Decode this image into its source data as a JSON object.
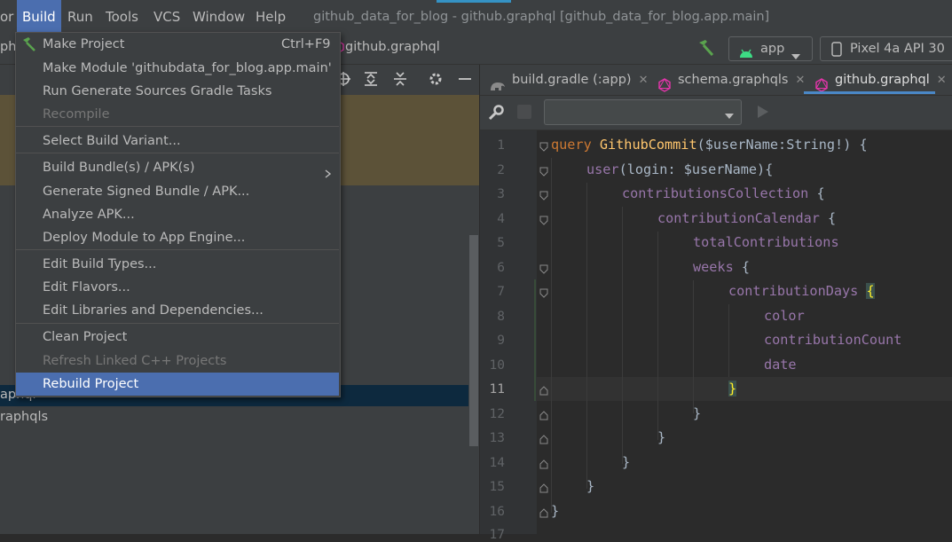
{
  "menubar": {
    "items": [
      {
        "label": "or"
      },
      {
        "label": "Build"
      },
      {
        "label": "Run"
      },
      {
        "label": "Tools"
      },
      {
        "label": "VCS"
      },
      {
        "label": "Window"
      },
      {
        "label": "Help"
      }
    ],
    "window_title": "github_data_for_blog - github.graphql [github_data_for_blog.app.main]"
  },
  "toolbar": {
    "breadcrumb_left": "ph",
    "breadcrumb_file": "github.graphql",
    "run_config": "app",
    "device": "Pixel 4a API 30"
  },
  "project_tree": {
    "rows": [
      {
        "label": "aphql"
      },
      {
        "label": "raphqls"
      }
    ]
  },
  "build_menu": {
    "items": [
      {
        "label": "Make Project",
        "shortcut": "Ctrl+F9"
      },
      {
        "label": "Make Module 'githubdata_for_blog.app.main'"
      },
      {
        "label": "Run Generate Sources Gradle Tasks"
      },
      {
        "label": "Recompile"
      },
      {
        "label": "Select Build Variant..."
      },
      {
        "label": "Build Bundle(s) / APK(s)"
      },
      {
        "label": "Generate Signed Bundle / APK..."
      },
      {
        "label": "Analyze APK..."
      },
      {
        "label": "Deploy Module to App Engine..."
      },
      {
        "label": "Edit Build Types..."
      },
      {
        "label": "Edit Flavors..."
      },
      {
        "label": "Edit Libraries and Dependencies..."
      },
      {
        "label": "Clean Project"
      },
      {
        "label": "Refresh Linked C++ Projects"
      },
      {
        "label": "Rebuild Project"
      }
    ]
  },
  "editor": {
    "tabs": [
      {
        "label": "build.gradle (:app)"
      },
      {
        "label": "schema.graphqls"
      },
      {
        "label": "github.graphql"
      }
    ],
    "line_numbers": [
      "1",
      "2",
      "3",
      "4",
      "5",
      "6",
      "7",
      "8",
      "9",
      "10",
      "11",
      "12",
      "13",
      "14",
      "15",
      "16",
      "17"
    ],
    "code": {
      "l1_kw": "query",
      "l1_name": "GithubCommit",
      "l1_rest": "($userName:String!) {",
      "l2_field": "user",
      "l2_rest": "(login: $userName){",
      "l3": "contributionsCollection",
      "l4": "contributionCalendar",
      "l5": "totalContributions",
      "l6": "weeks",
      "l7": "contributionDays",
      "l8": "color",
      "l9": "contributionCount",
      "l10": "date",
      "open_brace": "{",
      "close_brace": "}"
    }
  },
  "colors": {
    "accent": "#4b6eaf",
    "android_green": "#3ddc84",
    "graphql_pink": "#e535ab"
  }
}
